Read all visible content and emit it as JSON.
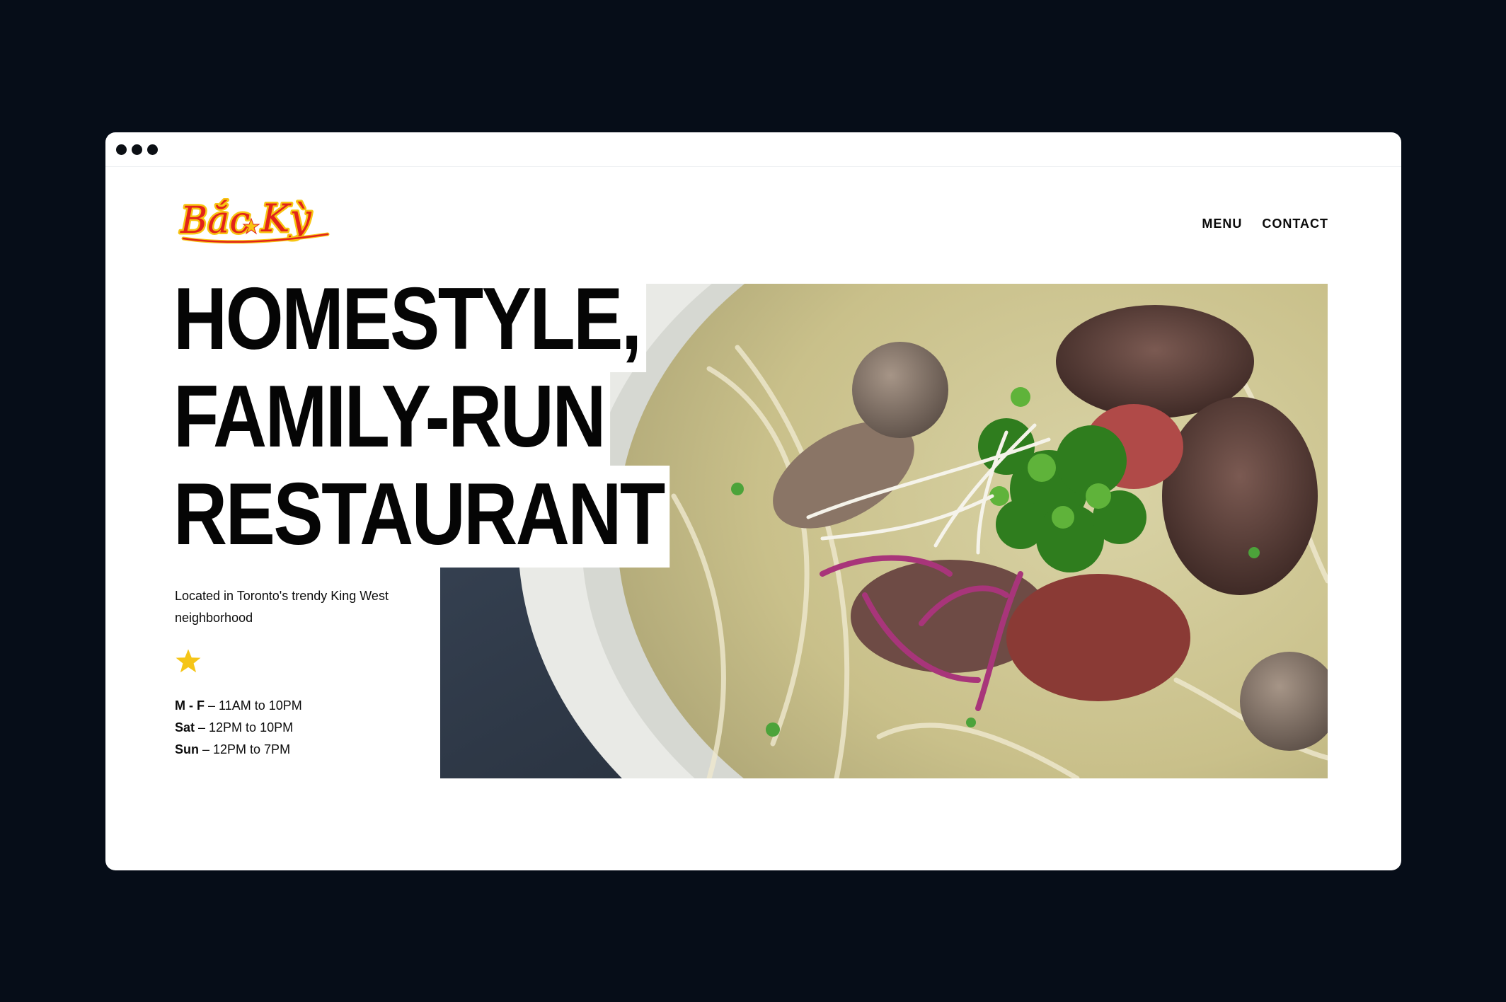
{
  "brand": {
    "logo_text": "Bắc Kỳ",
    "logo_color": "#e2231a",
    "logo_outline": "#f7c512"
  },
  "nav": {
    "items": [
      {
        "label": "MENU"
      },
      {
        "label": "CONTACT"
      }
    ]
  },
  "hero": {
    "headline": [
      "HOMESTYLE,",
      "FAMILY-RUN",
      "RESTAURANT"
    ],
    "location": "Located in Toronto's trendy King West neighborhood",
    "star_color": "#f5c518",
    "image_alt": "bowl of pho with beef, meatballs, herbs and red onion"
  },
  "hours": [
    {
      "days": "M - F",
      "sep": " – ",
      "time": "11AM to 10PM"
    },
    {
      "days": "Sat",
      "sep": " – ",
      "time": "12PM to 10PM"
    },
    {
      "days": "Sun",
      "sep": " – ",
      "time": "12PM to 7PM"
    }
  ]
}
